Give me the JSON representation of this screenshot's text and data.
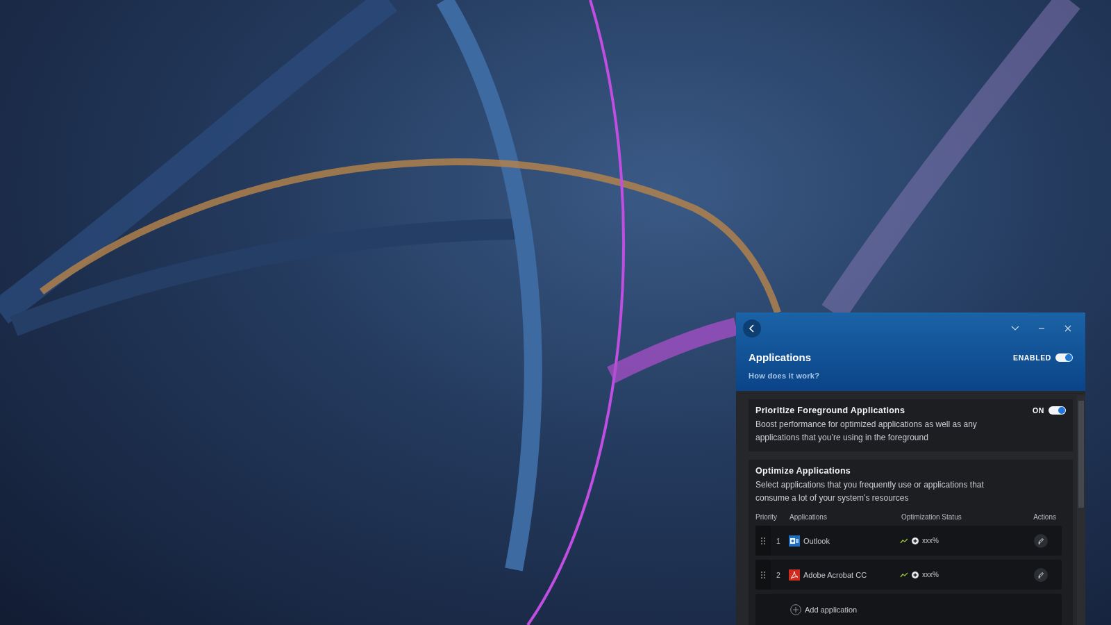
{
  "header": {
    "title": "Applications",
    "help_link": "How does it work?",
    "enabled_toggle": {
      "label": "ENABLED",
      "on": true
    }
  },
  "sections": [
    {
      "title": "Prioritize Foreground Applications",
      "description": "Boost performance for optimized applications as well as any applications that you’re using in the foreground",
      "toggle": {
        "label": "ON",
        "on": true
      }
    },
    {
      "title": "Optimize Applications",
      "description": "Select applications that you frequently use or applications that consume a lot of your system’s resources"
    }
  ],
  "table": {
    "columns": [
      "Priority",
      "Applications",
      "Optimization Status",
      "Actions"
    ],
    "rows": [
      {
        "priority": "1",
        "app": "Outlook",
        "kind": "mail",
        "status": "xxx%"
      },
      {
        "priority": "2",
        "app": "Adobe Acrobat CC",
        "kind": "pdf",
        "status": "xxx%"
      }
    ]
  },
  "add_button": "Add application"
}
